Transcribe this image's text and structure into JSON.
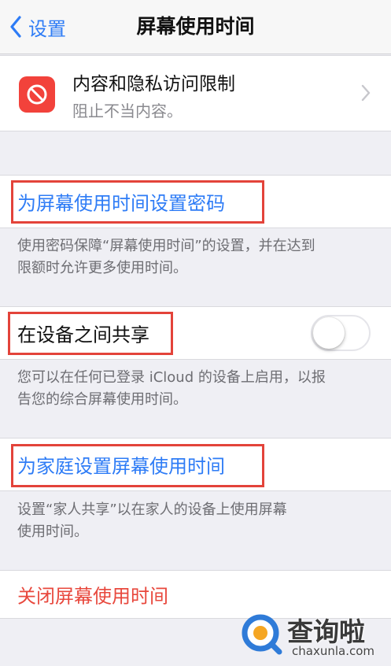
{
  "nav": {
    "back_label": "设置",
    "title": "屏幕使用时间"
  },
  "content_restrictions": {
    "title": "内容和隐私访问限制",
    "subtitle": "阻止不当内容。",
    "icon": "no-entry-icon"
  },
  "passcode": {
    "label": "为屏幕使用时间设置密码",
    "footer": [
      "使用密码保障“屏幕使用时间”的设置，并在达到",
      "限额时允许更多使用时间。"
    ]
  },
  "share_across_devices": {
    "label": "在设备之间共享",
    "enabled": false,
    "footer": [
      "您可以在任何已登录 iCloud 的设备上启用，以报",
      "告您的综合屏幕使用时间。"
    ]
  },
  "family": {
    "label": "为家庭设置屏幕使用时间",
    "footer": [
      "设置“家人共享”以在家人的设备上使用屏幕",
      "使用时间。"
    ]
  },
  "turn_off": {
    "label": "关闭屏幕使用时间"
  },
  "watermark": {
    "name": "查询啦",
    "domain": "chaxunla.com"
  },
  "colors": {
    "accent_blue": "#2e7cf6",
    "destructive_red": "#e8483d",
    "highlight_red": "#e3433a",
    "background": "#efeff4"
  }
}
